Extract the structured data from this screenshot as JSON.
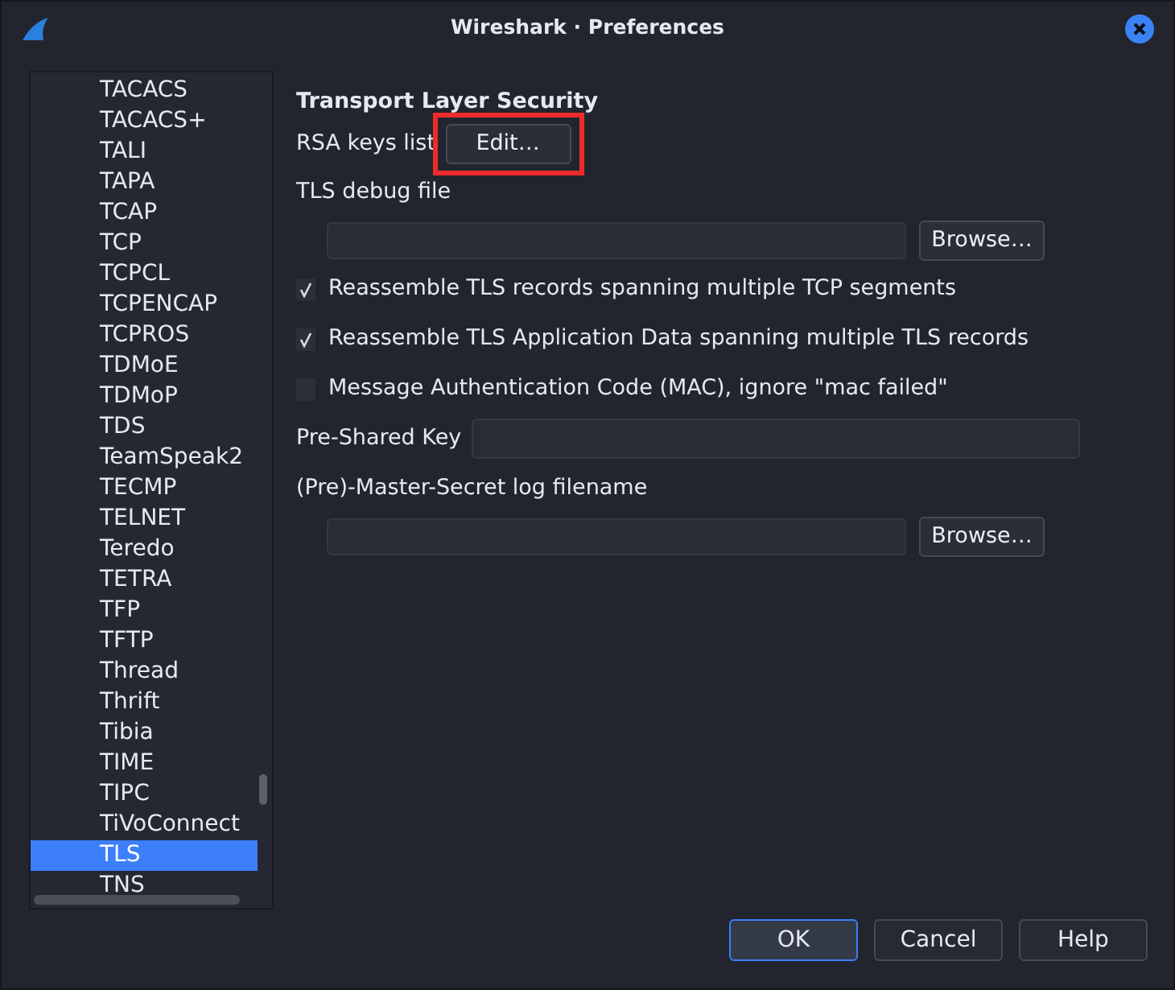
{
  "window": {
    "title": "Wireshark · Preferences"
  },
  "sidebar": {
    "items": [
      {
        "label": "TACACS",
        "selected": false
      },
      {
        "label": "TACACS+",
        "selected": false
      },
      {
        "label": "TALI",
        "selected": false
      },
      {
        "label": "TAPA",
        "selected": false
      },
      {
        "label": "TCAP",
        "selected": false
      },
      {
        "label": "TCP",
        "selected": false
      },
      {
        "label": "TCPCL",
        "selected": false
      },
      {
        "label": "TCPENCAP",
        "selected": false
      },
      {
        "label": "TCPROS",
        "selected": false
      },
      {
        "label": "TDMoE",
        "selected": false
      },
      {
        "label": "TDMoP",
        "selected": false
      },
      {
        "label": "TDS",
        "selected": false
      },
      {
        "label": "TeamSpeak2",
        "selected": false
      },
      {
        "label": "TECMP",
        "selected": false
      },
      {
        "label": "TELNET",
        "selected": false
      },
      {
        "label": "Teredo",
        "selected": false
      },
      {
        "label": "TETRA",
        "selected": false
      },
      {
        "label": "TFP",
        "selected": false
      },
      {
        "label": "TFTP",
        "selected": false
      },
      {
        "label": "Thread",
        "selected": false
      },
      {
        "label": "Thrift",
        "selected": false
      },
      {
        "label": "Tibia",
        "selected": false
      },
      {
        "label": "TIME",
        "selected": false
      },
      {
        "label": "TIPC",
        "selected": false
      },
      {
        "label": "TiVoConnect",
        "selected": false
      },
      {
        "label": "TLS",
        "selected": true
      },
      {
        "label": "TNS",
        "selected": false
      }
    ]
  },
  "panel": {
    "title": "Transport Layer Security",
    "rows": [
      {
        "kind": "button",
        "label": "RSA keys list",
        "button": "Edit…",
        "highlighted": true
      },
      {
        "kind": "label",
        "label": "TLS debug file"
      },
      {
        "kind": "file",
        "button": "Browse…"
      },
      {
        "kind": "checkbox",
        "label": "Reassemble TLS records spanning multiple TCP segments",
        "checked": true
      },
      {
        "kind": "checkbox",
        "label": "Reassemble TLS Application Data spanning multiple TLS records",
        "checked": true
      },
      {
        "kind": "checkbox",
        "label": "Message Authentication Code (MAC), ignore \"mac failed\"",
        "checked": false
      },
      {
        "kind": "text",
        "label": "Pre-Shared Key"
      },
      {
        "kind": "label",
        "label": "(Pre)-Master-Secret log filename"
      },
      {
        "kind": "file",
        "button": "Browse…"
      }
    ]
  },
  "buttons": [
    {
      "label": "OK",
      "default": true
    },
    {
      "label": "Cancel",
      "default": false
    },
    {
      "label": "Help",
      "default": false
    }
  ]
}
